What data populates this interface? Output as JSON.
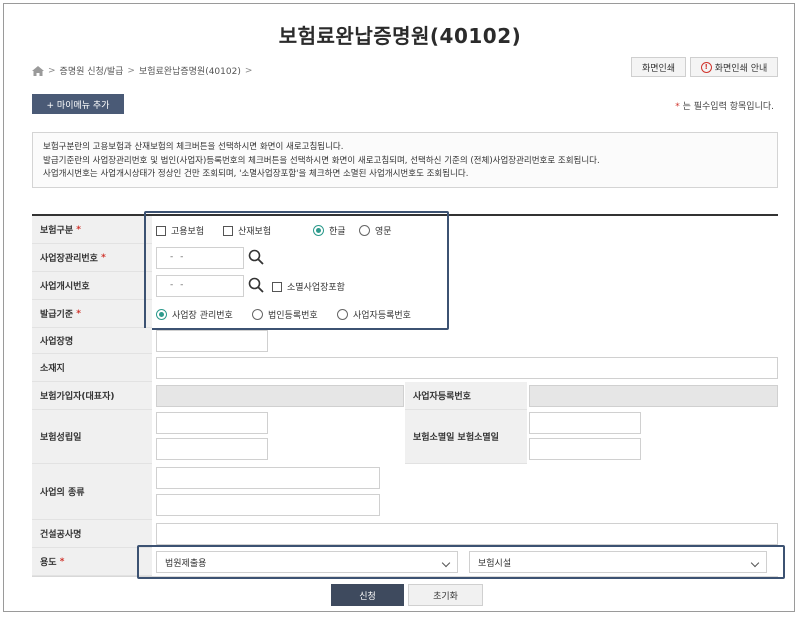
{
  "title": "보험료완납증명원(40102)",
  "breadcrumb": [
    "증명원 신청/발급",
    "보험료완납증명원(40102)"
  ],
  "print_button": "화면인쇄",
  "print_guide_button": "화면인쇄 안내",
  "mymenu_button": "+ 마이메뉴 추가",
  "required_note": "는 필수입력 항목입니다.",
  "required_mark": "*",
  "info_lines": [
    "보험구분란의 고용보험과 산재보험의 체크버튼을 선택하시면 화면이 새로고침됩니다.",
    "발급기준란의 사업장관리번호 및 법인(사업자)등록번호의 체크버튼을 선택하시면 화면이 새로고침되며, 선택하신 기준의 (전체)사업장관리번호로 조회됩니다.",
    "사업개시번호는 사업개시상태가 정상인 건만 조회되며, '소멸사업장포함'을 체크하면 소멸된 사업개시번호도 조회됩니다."
  ],
  "form": {
    "insurance_type": {
      "label": "보험구분",
      "options": [
        "고용보험",
        "산재보험"
      ],
      "language_options": [
        "한글",
        "영문"
      ],
      "language_selected": "한글"
    },
    "business_mgmt_no": {
      "label": "사업장관리번호",
      "placeholder": "- -"
    },
    "business_start_no": {
      "label": "사업개시번호",
      "placeholder": "- -",
      "include_closed": "소멸사업장포함"
    },
    "issue_basis": {
      "label": "발급기준",
      "options": [
        "사업장 관리번호",
        "법인등록번호",
        "사업자등록번호"
      ],
      "selected": "사업장 관리번호"
    },
    "business_name": {
      "label": "사업장명"
    },
    "address": {
      "label": "소재지"
    },
    "insured_rep": {
      "label": "보험가입자(대표자)"
    },
    "biz_reg_no": {
      "label": "사업자등록번호"
    },
    "established": {
      "label": "보험성립일"
    },
    "terminated": {
      "label": "보험소멸일 보험소멸일"
    },
    "business_type": {
      "label": "사업의 종류"
    },
    "construction_name": {
      "label": "건설공사명"
    },
    "purpose": {
      "label": "용도",
      "selected_1": "법원제출용",
      "selected_2": "보험시설"
    }
  },
  "submit_button": "신청",
  "reset_button": "초기화",
  "colors": {
    "highlight": "#3c5272",
    "radio_on": "#2d9a8c",
    "required": "#d0342c",
    "primary_button": "#3e4a5e"
  }
}
